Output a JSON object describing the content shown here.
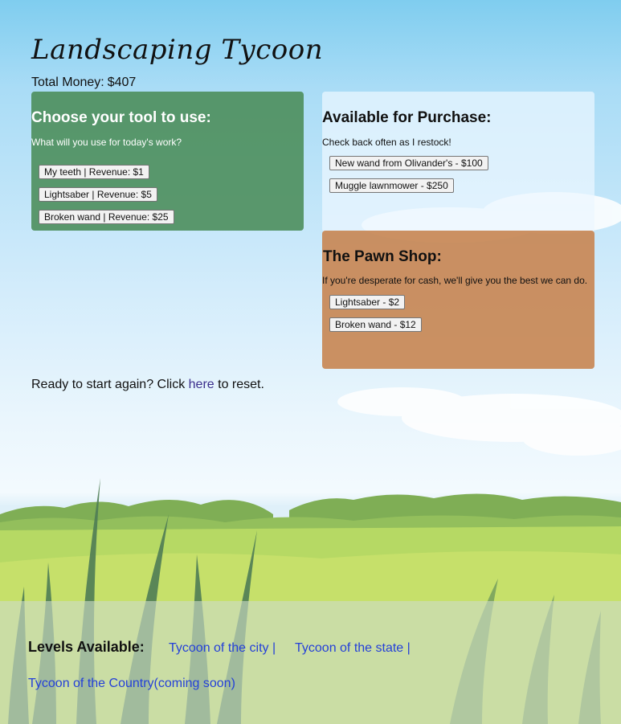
{
  "game": {
    "title": "Landscaping Tycoon",
    "money_label": "Total Money:",
    "money_value": "$407"
  },
  "tools_panel": {
    "heading": "Choose your tool to use:",
    "subtext": "What will you use for today's work?",
    "buttons": [
      "My teeth | Revenue: $1",
      "Lightsaber | Revenue: $5",
      "Broken wand | Revenue: $25"
    ]
  },
  "shop_panel": {
    "heading": "Available for Purchase:",
    "subtext": "Check back often as I restock!",
    "buttons": [
      "New wand from Olivander's - $100",
      "Muggle lawnmower - $250"
    ]
  },
  "pawn_panel": {
    "heading": "The Pawn Shop:",
    "subtext": "If you're desperate for cash, we'll give you the best we can do.",
    "buttons": [
      "Lightsaber - $2",
      "Broken wand - $12"
    ]
  },
  "reset": {
    "prefix": "Ready to start again? Click ",
    "link": "here",
    "suffix": " to reset."
  },
  "footer": {
    "levels_title": "Levels Available:",
    "levels": [
      "Tycoon of the city |",
      "Tycoon of the state |",
      "Tycoon of the Country(coming soon)"
    ]
  },
  "colors": {
    "tools_panel_bg": "#4a8c58",
    "pawn_panel_bg": "#c88a5a",
    "link_blue": "#2440d8",
    "reset_link": "#3b2e8c"
  }
}
